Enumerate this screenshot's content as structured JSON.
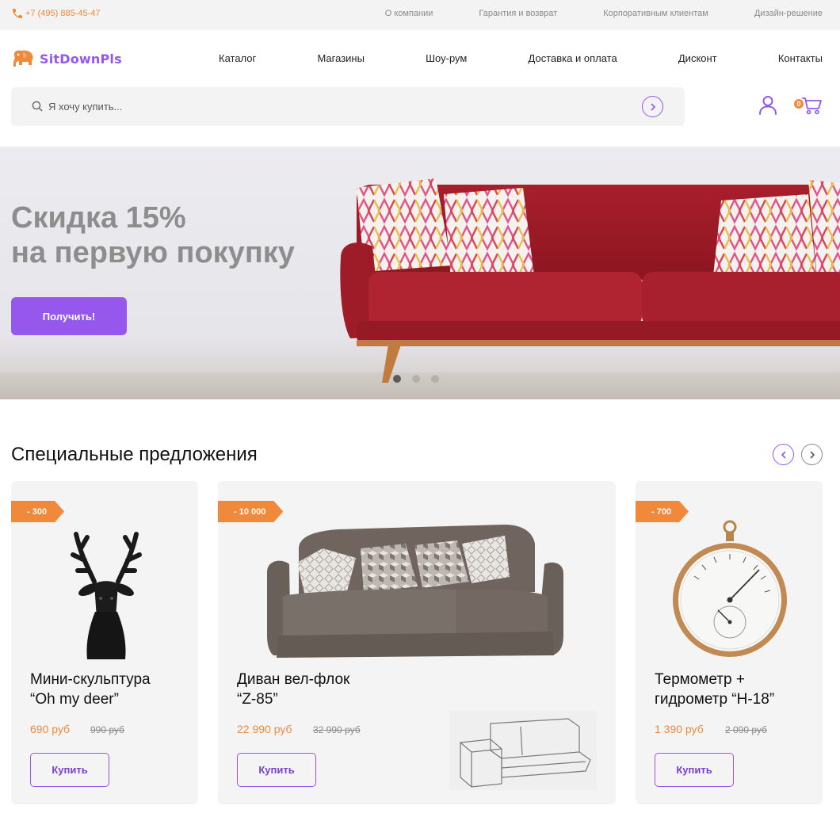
{
  "topbar": {
    "phone": "+7 (495) 885-45-47",
    "links": [
      "О компании",
      "Гарантия и возврат",
      "Корпоративным клиентам",
      "Дизайн-решение"
    ]
  },
  "header": {
    "logo": "SitDownPls",
    "nav": [
      "Каталог",
      "Магазины",
      "Шоу-рум",
      "Доставка и оплата",
      "Дисконт",
      "Контакты"
    ],
    "search_placeholder": "Я хочу купить...",
    "cart_count": "0"
  },
  "hero": {
    "title_line1": "Скидка 15%",
    "title_line2": "на первую покупку",
    "button": "Получить!",
    "slides": 3,
    "active_slide": 0
  },
  "offers": {
    "title": "Специальные предложения",
    "cards": [
      {
        "badge": "- 300",
        "title_line1": "Мини-скульптура",
        "title_line2": "“Oh my deer”",
        "price": "690 руб",
        "old_price": "990 руб",
        "button": "Купить"
      },
      {
        "badge": "- 10 000",
        "title_line1": "Диван вел-флок",
        "title_line2": "“Z-85”",
        "price": "22 990 руб",
        "old_price": "32 990 руб",
        "button": "Купить"
      },
      {
        "badge": "- 700",
        "title_line1": "Термометр +",
        "title_line2": "гидрометр “H-18”",
        "price": "1 390 руб",
        "old_price": "2 090 руб",
        "button": "Купить"
      }
    ]
  },
  "colors": {
    "accent": "#9657ec",
    "orange": "#f0893a",
    "muted": "#8a8a8a"
  }
}
